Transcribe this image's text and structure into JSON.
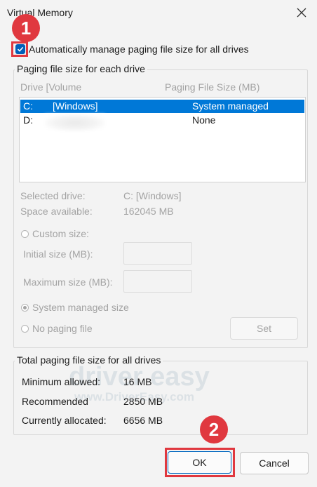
{
  "window": {
    "title": "Virtual Memory"
  },
  "auto_manage": {
    "label": "Automatically manage paging file size for all drives",
    "checked": true
  },
  "each_drive": {
    "group_label": "Paging file size for each drive",
    "headers": {
      "drive_volume": "Drive  [Volume",
      "paging_size": "Paging File Size (MB)"
    },
    "rows": [
      {
        "drive": "C:",
        "volume": "[Windows]",
        "size": "System managed",
        "selected": true
      },
      {
        "drive": "D:",
        "volume": "",
        "size": "None",
        "selected": false
      }
    ],
    "selected_drive_label": "Selected drive:",
    "selected_drive_value": "C:  [Windows]",
    "space_label": "Space available:",
    "space_value": "162045 MB",
    "custom_size": "Custom size:",
    "initial_size": "Initial size (MB):",
    "maximum_size": "Maximum size (MB):",
    "system_managed": "System managed size",
    "no_paging": "No paging file",
    "set_button": "Set"
  },
  "total": {
    "group_label": "Total paging file size for all drives",
    "min_label": "Minimum allowed:",
    "min_value": "16 MB",
    "rec_label": "Recommended",
    "rec_value": "2850 MB",
    "alloc_label": "Currently allocated:",
    "alloc_value": "6656 MB"
  },
  "buttons": {
    "ok": "OK",
    "cancel": "Cancel"
  },
  "callouts": {
    "one": "1",
    "two": "2"
  },
  "watermark": {
    "logo": "driver easy",
    "url": "www.DriverEasy.com"
  },
  "colors": {
    "accent": "#005fb8",
    "selection": "#0078d7",
    "callout": "#e0383f"
  }
}
